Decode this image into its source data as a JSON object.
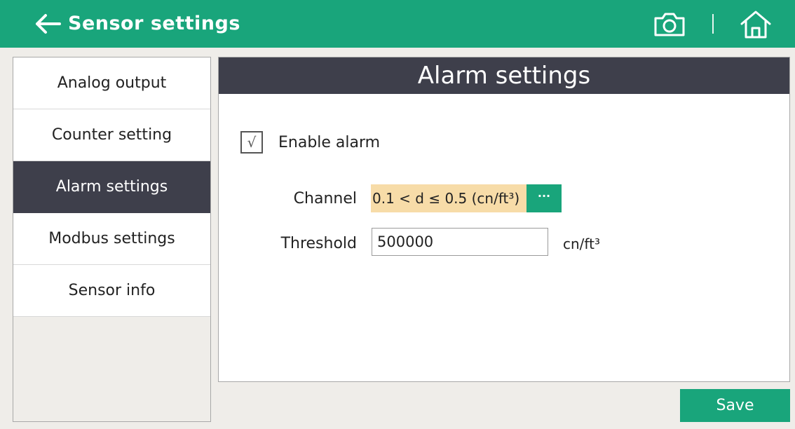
{
  "header": {
    "title": "Sensor settings",
    "back_icon": "arrow-left-icon",
    "camera_icon": "camera-icon",
    "home_icon": "home-icon",
    "background_color": "#19a57b"
  },
  "sidebar": {
    "items": [
      {
        "label": "Analog output",
        "active": false
      },
      {
        "label": "Counter setting",
        "active": false
      },
      {
        "label": "Alarm settings",
        "active": true
      },
      {
        "label": "Modbus settings",
        "active": false
      },
      {
        "label": "Sensor info",
        "active": false
      }
    ],
    "active_color": "#3e3f4b"
  },
  "panel": {
    "title": "Alarm settings",
    "enable_alarm": {
      "label": "Enable alarm",
      "checked": true,
      "check_glyph": "√"
    },
    "channel": {
      "label": "Channel",
      "value": "0.1 < d ≤ 0.5 (cn/ft³)",
      "more_label": "···",
      "highlight_color": "#f7dca8"
    },
    "threshold": {
      "label": "Threshold",
      "value": "500000",
      "unit": "cn/ft³"
    }
  },
  "save_label": "Save",
  "accent_color": "#19a57b"
}
